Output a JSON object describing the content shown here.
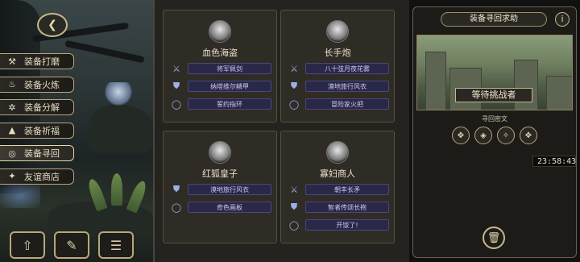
{
  "menu": [
    {
      "label": "装备打磨",
      "icon": "hammer-icon",
      "glyph": "⚒"
    },
    {
      "label": "装备火炼",
      "icon": "flame-icon",
      "glyph": "♨"
    },
    {
      "label": "装备分解",
      "icon": "gear-break-icon",
      "glyph": "✲"
    },
    {
      "label": "装备祈福",
      "icon": "altar-icon",
      "glyph": "▲"
    },
    {
      "label": "装备寻回",
      "icon": "spiral-icon",
      "glyph": "◎",
      "active": true
    },
    {
      "label": "友谊商店",
      "icon": "fox-icon",
      "glyph": "✦"
    }
  ],
  "cards": [
    {
      "name": "血色海盗",
      "avatar": "pirate-portrait",
      "items": [
        {
          "icon": "sword-icon",
          "glyph": "⚔",
          "label": "将军佩剑"
        },
        {
          "icon": "armor-icon",
          "glyph": "⛊",
          "label": "纳塔维尔鳞甲"
        },
        {
          "icon": "ring-icon",
          "glyph": "◯",
          "label": "誓约指环"
        }
      ]
    },
    {
      "name": "长手炮",
      "avatar": "cannon-portrait",
      "items": [
        {
          "icon": "blade-icon",
          "glyph": "⚔",
          "label": "八十弦月夜花雾"
        },
        {
          "icon": "cloak-icon",
          "glyph": "⛊",
          "label": "漠地旅行风衣"
        },
        {
          "icon": "torch-icon",
          "glyph": "◯",
          "label": "冒险家火把"
        }
      ]
    },
    {
      "name": "红狐皇子",
      "avatar": "fox-prince-portrait",
      "items": [
        {
          "icon": "cloak-icon",
          "glyph": "⛊",
          "label": "漠地旅行风衣"
        },
        {
          "icon": "ring-icon",
          "glyph": "◯",
          "label": "奇色画板"
        }
      ]
    },
    {
      "name": "寡妇商人",
      "avatar": "widow-merchant-portrait",
      "items": [
        {
          "icon": "spear-icon",
          "glyph": "⚔",
          "label": "朝丰长矛"
        },
        {
          "icon": "robe-icon",
          "glyph": "⛊",
          "label": "智者传颂长袍"
        },
        {
          "icon": "ring-icon",
          "glyph": "◯",
          "label": "开饭了!"
        }
      ]
    }
  ],
  "panel": {
    "title": "装备寻回求助",
    "info_glyph": "i",
    "status": "等待挑战者",
    "cipher_label": "寻回密文",
    "ciphers": [
      {
        "icon": "cipher-rune-1-icon",
        "glyph": "✥"
      },
      {
        "icon": "cipher-rune-2-icon",
        "glyph": "◈"
      },
      {
        "icon": "cipher-rune-3-icon",
        "glyph": "✧"
      },
      {
        "icon": "cipher-rune-4-icon",
        "glyph": "✥"
      }
    ],
    "timer": "23:58:43"
  },
  "tools": [
    {
      "icon": "upload-icon",
      "glyph": "⇧"
    },
    {
      "icon": "feather-icon",
      "glyph": "✎"
    },
    {
      "icon": "list-icon",
      "glyph": "☰"
    }
  ],
  "collapse_glyph": "❮",
  "trash_glyph": "🗑"
}
